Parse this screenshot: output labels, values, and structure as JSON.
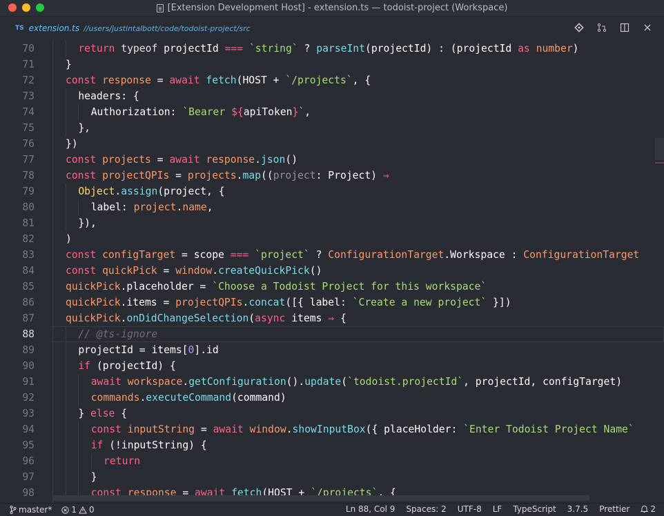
{
  "window": {
    "title": "[Extension Development Host] - extension.ts — todoist-project (Workspace)"
  },
  "tab": {
    "badge": "TS",
    "filename": "extension.ts",
    "path": "//users/justintalbott/code/todoist-project/src"
  },
  "toolbar": {
    "icons": [
      "git-compare-icon",
      "git-pull-request-icon",
      "split-editor-icon",
      "close-icon"
    ]
  },
  "editor": {
    "current_line": 88,
    "lines": [
      {
        "n": "70",
        "indent": 1,
        "tokens": [
          [
            "k",
            "return"
          ],
          [
            "p",
            " "
          ],
          [
            "w",
            "typeof"
          ],
          [
            "p",
            " projectId "
          ],
          [
            "k",
            "==="
          ],
          [
            "p",
            " "
          ],
          [
            "s",
            "`string`"
          ],
          [
            "p",
            " ? "
          ],
          [
            "f",
            "parseInt"
          ],
          [
            "p",
            "(projectId) : (projectId "
          ],
          [
            "k",
            "as"
          ],
          [
            "p",
            " "
          ],
          [
            "v",
            "number"
          ],
          [
            "p",
            ")"
          ]
        ]
      },
      {
        "n": "71",
        "indent": 0,
        "tokens": [
          [
            "p",
            "}"
          ]
        ]
      },
      {
        "n": "72",
        "indent": 0,
        "tokens": [
          [
            "k",
            "const"
          ],
          [
            "p",
            " "
          ],
          [
            "v",
            "response"
          ],
          [
            "p",
            " = "
          ],
          [
            "k",
            "await"
          ],
          [
            "p",
            " "
          ],
          [
            "f",
            "fetch"
          ],
          [
            "p",
            "(HOST + "
          ],
          [
            "s",
            "`/projects`"
          ],
          [
            "p",
            ", {"
          ]
        ]
      },
      {
        "n": "73",
        "indent": 1,
        "tokens": [
          [
            "p",
            "headers: {"
          ]
        ]
      },
      {
        "n": "74",
        "indent": 2,
        "tokens": [
          [
            "p",
            "Authorization: "
          ],
          [
            "s",
            "`Bearer "
          ],
          [
            "k",
            "${"
          ],
          [
            "p",
            "apiToken"
          ],
          [
            "k",
            "}"
          ],
          [
            "s",
            "`"
          ],
          [
            "p",
            ","
          ]
        ]
      },
      {
        "n": "75",
        "indent": 1,
        "tokens": [
          [
            "p",
            "},"
          ]
        ]
      },
      {
        "n": "76",
        "indent": 0,
        "tokens": [
          [
            "p",
            "})"
          ]
        ]
      },
      {
        "n": "77",
        "indent": 0,
        "tokens": [
          [
            "k",
            "const"
          ],
          [
            "p",
            " "
          ],
          [
            "v",
            "projects"
          ],
          [
            "p",
            " = "
          ],
          [
            "k",
            "await"
          ],
          [
            "p",
            " "
          ],
          [
            "v",
            "response"
          ],
          [
            "p",
            "."
          ],
          [
            "f",
            "json"
          ],
          [
            "p",
            "()"
          ]
        ]
      },
      {
        "n": "78",
        "indent": 0,
        "tokens": [
          [
            "k",
            "const"
          ],
          [
            "p",
            " "
          ],
          [
            "v",
            "projectQPIs"
          ],
          [
            "p",
            " = "
          ],
          [
            "v",
            "projects"
          ],
          [
            "p",
            "."
          ],
          [
            "f",
            "map"
          ],
          [
            "p",
            "(("
          ],
          [
            "a",
            "project"
          ],
          [
            "p",
            ": Project) "
          ],
          [
            "k",
            "⇒"
          ]
        ]
      },
      {
        "n": "79",
        "indent": 1,
        "tokens": [
          [
            "y",
            "Object"
          ],
          [
            "p",
            "."
          ],
          [
            "f",
            "assign"
          ],
          [
            "p",
            "(project, {"
          ]
        ]
      },
      {
        "n": "80",
        "indent": 2,
        "tokens": [
          [
            "p",
            "label: "
          ],
          [
            "v",
            "project"
          ],
          [
            "p",
            "."
          ],
          [
            "v",
            "name"
          ],
          [
            "p",
            ","
          ]
        ]
      },
      {
        "n": "81",
        "indent": 1,
        "tokens": [
          [
            "p",
            "}),"
          ]
        ]
      },
      {
        "n": "82",
        "indent": 0,
        "tokens": [
          [
            "p",
            ")"
          ]
        ]
      },
      {
        "n": "83",
        "indent": 0,
        "tokens": [
          [
            "k",
            "const"
          ],
          [
            "p",
            " "
          ],
          [
            "v",
            "configTarget"
          ],
          [
            "p",
            " = scope "
          ],
          [
            "k",
            "==="
          ],
          [
            "p",
            " "
          ],
          [
            "s",
            "`project`"
          ],
          [
            "p",
            " ? "
          ],
          [
            "v",
            "ConfigurationTarget"
          ],
          [
            "p",
            ".Workspace : "
          ],
          [
            "v",
            "ConfigurationTarget"
          ]
        ]
      },
      {
        "n": "84",
        "indent": 0,
        "tokens": [
          [
            "k",
            "const"
          ],
          [
            "p",
            " "
          ],
          [
            "v",
            "quickPick"
          ],
          [
            "p",
            " = "
          ],
          [
            "v",
            "window"
          ],
          [
            "p",
            "."
          ],
          [
            "f",
            "createQuickPick"
          ],
          [
            "p",
            "()"
          ]
        ]
      },
      {
        "n": "85",
        "indent": 0,
        "tokens": [
          [
            "v",
            "quickPick"
          ],
          [
            "p",
            ".placeholder = "
          ],
          [
            "s",
            "`Choose a Todoist Project for this workspace`"
          ]
        ]
      },
      {
        "n": "86",
        "indent": 0,
        "tokens": [
          [
            "v",
            "quickPick"
          ],
          [
            "p",
            ".items = "
          ],
          [
            "v",
            "projectQPIs"
          ],
          [
            "p",
            "."
          ],
          [
            "f",
            "concat"
          ],
          [
            "p",
            "([{ label: "
          ],
          [
            "s",
            "`Create a new project`"
          ],
          [
            "p",
            " }])"
          ]
        ]
      },
      {
        "n": "87",
        "indent": 0,
        "tokens": [
          [
            "v",
            "quickPick"
          ],
          [
            "p",
            "."
          ],
          [
            "f",
            "onDidChangeSelection"
          ],
          [
            "p",
            "("
          ],
          [
            "k",
            "async"
          ],
          [
            "p",
            " items "
          ],
          [
            "k",
            "⇒"
          ],
          [
            "p",
            " {"
          ]
        ]
      },
      {
        "n": "88",
        "indent": 1,
        "tokens": [
          [
            "c",
            "// @ts-ignore"
          ]
        ]
      },
      {
        "n": "89",
        "indent": 1,
        "tokens": [
          [
            "p",
            "projectId = items["
          ],
          [
            "t",
            "0"
          ],
          [
            "p",
            "].id"
          ]
        ]
      },
      {
        "n": "90",
        "indent": 1,
        "tokens": [
          [
            "k",
            "if"
          ],
          [
            "p",
            " (projectId) {"
          ]
        ]
      },
      {
        "n": "91",
        "indent": 2,
        "tokens": [
          [
            "k",
            "await"
          ],
          [
            "p",
            " "
          ],
          [
            "v",
            "workspace"
          ],
          [
            "p",
            "."
          ],
          [
            "f",
            "getConfiguration"
          ],
          [
            "p",
            "()."
          ],
          [
            "f",
            "update"
          ],
          [
            "p",
            "("
          ],
          [
            "s",
            "`todoist.projectId`"
          ],
          [
            "p",
            ", projectId, configTarget)"
          ]
        ]
      },
      {
        "n": "92",
        "indent": 2,
        "tokens": [
          [
            "v",
            "commands"
          ],
          [
            "p",
            "."
          ],
          [
            "f",
            "executeCommand"
          ],
          [
            "p",
            "(command)"
          ]
        ]
      },
      {
        "n": "93",
        "indent": 1,
        "tokens": [
          [
            "p",
            "} "
          ],
          [
            "k",
            "else"
          ],
          [
            "p",
            " {"
          ]
        ]
      },
      {
        "n": "94",
        "indent": 2,
        "tokens": [
          [
            "k",
            "const"
          ],
          [
            "p",
            " "
          ],
          [
            "v",
            "inputString"
          ],
          [
            "p",
            " = "
          ],
          [
            "k",
            "await"
          ],
          [
            "p",
            " "
          ],
          [
            "v",
            "window"
          ],
          [
            "p",
            "."
          ],
          [
            "f",
            "showInputBox"
          ],
          [
            "p",
            "({ placeHolder: "
          ],
          [
            "s",
            "`Enter Todoist Project Name`"
          ]
        ]
      },
      {
        "n": "95",
        "indent": 2,
        "tokens": [
          [
            "k",
            "if"
          ],
          [
            "p",
            " (!inputString) {"
          ]
        ]
      },
      {
        "n": "96",
        "indent": 3,
        "tokens": [
          [
            "k",
            "return"
          ]
        ]
      },
      {
        "n": "97",
        "indent": 2,
        "tokens": [
          [
            "p",
            "}"
          ]
        ]
      },
      {
        "n": "98",
        "indent": 2,
        "tokens": [
          [
            "k",
            "const"
          ],
          [
            "p",
            " "
          ],
          [
            "v",
            "response"
          ],
          [
            "p",
            " = "
          ],
          [
            "k",
            "await"
          ],
          [
            "p",
            " "
          ],
          [
            "f",
            "fetch"
          ],
          [
            "p",
            "(HOST + "
          ],
          [
            "s",
            "`/projects`"
          ],
          [
            "p",
            ", {"
          ]
        ]
      }
    ]
  },
  "statusbar": {
    "branch": "master*",
    "errors": "1",
    "warnings": "0",
    "position": "Ln 88, Col 9",
    "spaces": "Spaces: 2",
    "encoding": "UTF-8",
    "eol": "LF",
    "language": "TypeScript",
    "version": "3.7.5",
    "formatter": "Prettier",
    "notifications": "2"
  },
  "colors": {
    "keyword": "#ff6188",
    "variable": "#fc9867",
    "function": "#78dce8",
    "string": "#a9dc76",
    "background": "#2a2c33"
  }
}
